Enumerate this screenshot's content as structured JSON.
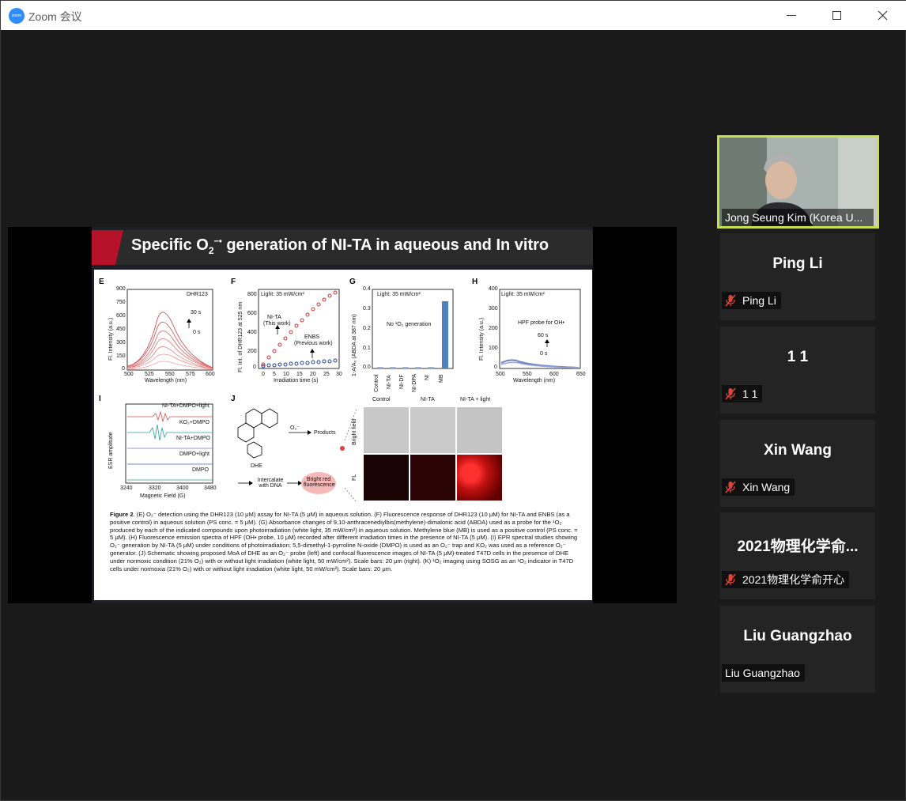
{
  "window": {
    "title": "Zoom 会议",
    "app_icon_text": "zoom"
  },
  "slide": {
    "title_pre": "Specific O",
    "title_sub": "2",
    "title_sup": "−•",
    "title_post": " generation of NI-TA in aqueous and In vitro",
    "panels": {
      "E": {
        "letter": "E",
        "label_box": "DHR123",
        "annot_top": "30 s",
        "annot_bottom": "0 s",
        "ylabel": "Fl. Intensity (a.u.)",
        "xlabel": "Wavelength (nm)",
        "yticks": [
          "900",
          "750",
          "600",
          "450",
          "300",
          "150",
          "0"
        ],
        "xticks": [
          "500",
          "525",
          "550",
          "575",
          "600"
        ]
      },
      "F": {
        "letter": "F",
        "light": "Light: 35 mW/cm²",
        "series1_line1": "NI-TA",
        "series1_line2": "(This work)",
        "series2_line1": "ENBS",
        "series2_line2": "(Previous work)",
        "ylabel": "Fl. Int. of DHR123 at 525 nm",
        "xlabel": "Irradiation time (s)",
        "yticks": [
          "800",
          "600",
          "400",
          "200",
          "0"
        ],
        "xticks": [
          "0",
          "5",
          "10",
          "15",
          "20",
          "25",
          "30"
        ]
      },
      "G": {
        "letter": "G",
        "light": "Light: 35 mW/cm²",
        "note": "No ¹O₂ generation",
        "ylabel": "1-A/A₀ (ABDA at 387 nm)",
        "yticks": [
          "0.4",
          "0.3",
          "0.2",
          "0.1",
          "0.0"
        ],
        "categories": [
          "Control",
          "NI-TA",
          "NI-DF",
          "NI-DPA",
          "NI",
          "MB"
        ]
      },
      "H": {
        "letter": "H",
        "light": "Light: 35 mW/cm²",
        "note": "HPF probe for OH•",
        "annot_top": "60 s",
        "annot_bottom": "0 s",
        "ylabel": "Fl. Intensity (a.u.)",
        "xlabel": "Wavelength (nm)",
        "yticks": [
          "400",
          "300",
          "200",
          "100",
          "0"
        ],
        "xticks": [
          "500",
          "550",
          "600",
          "650"
        ]
      },
      "I": {
        "letter": "I",
        "traces": [
          "NI-TA+DMPO+light",
          "KO₂+DMPO",
          "NI-TA+DMPO",
          "DMPO+light",
          "DMPO"
        ],
        "ylabel": "ESR amplitude",
        "xlabel": "Magnetic Field (G)",
        "xticks": [
          "3240",
          "3320",
          "3400",
          "3480"
        ]
      },
      "J": {
        "letter": "J",
        "molecule": "DHE",
        "reagent": "O₂⁻",
        "product": "Products",
        "intercalate": "Intercalate with DNA",
        "bright": "Bright red fluorescence",
        "col_headers": [
          "Control",
          "NI-TA",
          "NI-TA + light"
        ],
        "row_labels": [
          "Bright field",
          "FL"
        ]
      }
    },
    "caption": {
      "lead": "Figure 2",
      "text": ". (E) O₂⁻ detection using the DHR123 (10 μM) assay for NI-TA (5 μM) in aqueous solution. (F) Fluorescence response of DHR123 (10 μM) for NI-TA and ENBS (as a positive control) in aqueous solution (PS conc. = 5 μM). (G) Absorbance changes of 9,10-anthracenediylbis(methylene)-dimalonic acid (ABDA) used as a probe for the ¹O₂ produced by each of the indicated compounds upon photoirradiation (white light, 35 mW/cm²) in aqueous solution. Methylene blue (MB) is used as a positive control (PS conc. = 5 μM). (H) Fluorescence emission spectra of HPF (OH• probe, 10 μM) recorded after different irradiation times in the presence of NI-TA (5 μM). (I) EPR spectral studies showing O₂⁻ generation by NI-TA (5 μM) under conditions of photoirradiation; 5,5-dimethyl-1-pyrroline N-oxide (DMPO) is used as an O₂⁻ trap and KO₂ was used as a reference O₂⁻ generator. (J) Schematic showing proposed MoA of DHE as an O₂⁻ probe (left) and confocal fluorescence images of NI-TA (5 μM)-treated T47D cells in the presence of DHE under normoxic condition (21% O₂) with or without light irradiation (white light, 50 mW/cm²). Scale bars: 20 μm (right). (K) ¹O₂ imaging using SOSG as an ¹O₂ indicator in T47D cells under normoxia (21% O₂) with or without light irradiation (white light, 50 mW/cm²). Scale bars: 20 μm."
    }
  },
  "participants": [
    {
      "name": "Jong Seung Kim (Korea U...",
      "video": true,
      "muted": false
    },
    {
      "name": "Ping Li",
      "display": "Ping Li",
      "muted": true
    },
    {
      "name": "1 1",
      "display": "1 1",
      "muted": true
    },
    {
      "name": "Xin Wang",
      "display": "Xin Wang",
      "muted": true
    },
    {
      "name": "2021物理化学俞开心",
      "display": "2021物理化学俞...",
      "muted": true
    },
    {
      "name": "Liu Guangzhao",
      "display": "Liu Guangzhao",
      "muted": false
    }
  ],
  "colors": {
    "accent_red": "#b5122a",
    "active_speaker": "#c8e04a",
    "mute_red": "#e0453a",
    "zoom_blue": "#2d8cff"
  }
}
